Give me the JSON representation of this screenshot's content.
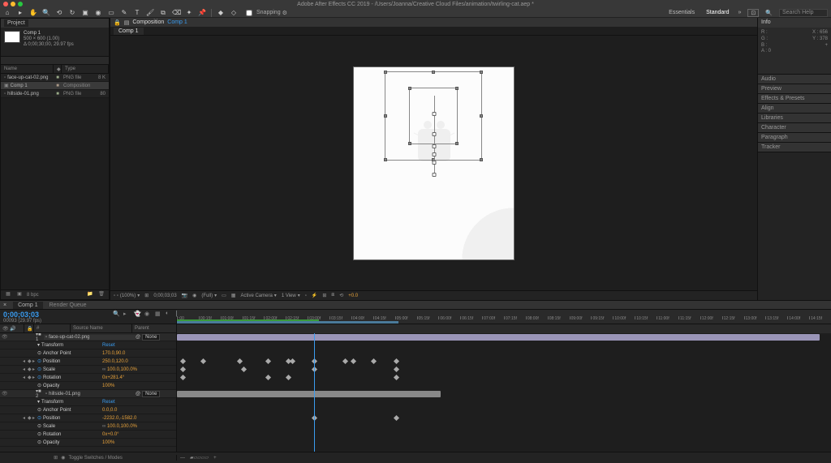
{
  "app": {
    "title": "Adobe After Effects CC 2019 - /Users/Joanna/Creative Cloud Files/animation/twirling-cat.aep *"
  },
  "toolbar": {
    "snapping_label": "Snapping",
    "workspaces": {
      "essentials": "Essentials",
      "standard": "Standard"
    },
    "search_placeholder": "Search Help"
  },
  "project": {
    "tab": "Project",
    "comp_name": "Comp 1",
    "comp_meta1": "500 × 600 (1.00)",
    "comp_meta2": "Δ 0;00;30;00, 29.97 fps",
    "cols": {
      "name": "Name",
      "type": "Type",
      "size": ""
    },
    "items": [
      {
        "name": "face-up-cat-02.png",
        "type": "PNG file",
        "size": "8 K"
      },
      {
        "name": "Comp 1",
        "type": "Composition",
        "size": ""
      },
      {
        "name": "hillside-01.png",
        "type": "PNG file",
        "size": "80"
      }
    ],
    "footer_bpc": "8 bpc"
  },
  "composition": {
    "label": "Composition",
    "name": "Comp 1",
    "tab": "Comp 1"
  },
  "viewer_footer": {
    "zoom": "(100%)",
    "time": "0;00;03;03",
    "res": "(Full)",
    "cam": "Active Camera",
    "view": "1 View",
    "exp": "+0.0"
  },
  "info": {
    "title": "Info",
    "x": "X : 656",
    "y": "Y : 378",
    "r": "R :",
    "g": "G :",
    "b": "B :",
    "a": "A : 0"
  },
  "right_panels": [
    "Audio",
    "Preview",
    "Effects & Presets",
    "Align",
    "Libraries",
    "Character",
    "Paragraph",
    "Tracker"
  ],
  "timeline": {
    "tab1": "Comp 1",
    "tab2": "Render Queue",
    "current_time": "0;00;03;03",
    "current_sub": "00093 (29.97 fps)",
    "cols": {
      "c1": "",
      "c2": "#",
      "c3": "Source Name",
      "c4": "Parent"
    },
    "ruler": [
      ":00",
      "00:15f",
      "01:00f",
      "01:15f",
      "02:00f",
      "02:15f",
      "03:00f",
      "03:15f",
      "04:00f",
      "04:15f",
      "05:00f",
      "05:15f",
      "06:00f",
      "06:15f",
      "07:00f",
      "07:15f",
      "08:00f",
      "08:15f",
      "09:00f",
      "09:15f",
      "10:00f",
      "10:15f",
      "11:00f",
      "11:15f",
      "12:00f",
      "12:15f",
      "13:00f",
      "13:15f",
      "14:00f",
      "14:15f"
    ],
    "parent_none": "None",
    "layer1": {
      "num": "1",
      "name": "face-up-cat-02.png",
      "transform": "Transform",
      "reset": "Reset",
      "props": [
        {
          "n": "Anchor Point",
          "v": "170.0,90.0",
          "kf": false
        },
        {
          "n": "Position",
          "v": "250.0,120.0",
          "kf": true
        },
        {
          "n": "Scale",
          "v": "100.0,100.0%",
          "kf": true,
          "link": true
        },
        {
          "n": "Rotation",
          "v": "0x+281.4°",
          "kf": true
        },
        {
          "n": "Opacity",
          "v": "100%",
          "kf": false
        }
      ]
    },
    "layer2": {
      "num": "2",
      "name": "hillside-01.png",
      "transform": "Transform",
      "reset": "Reset",
      "props": [
        {
          "n": "Anchor Point",
          "v": "0.0,0.0",
          "kf": false
        },
        {
          "n": "Position",
          "v": "-2232.0,-1582.0",
          "kf": true
        },
        {
          "n": "Scale",
          "v": "100.0,100.0%",
          "kf": false,
          "link": true
        },
        {
          "n": "Rotation",
          "v": "0x+0.0°",
          "kf": false
        },
        {
          "n": "Opacity",
          "v": "100%",
          "kf": false
        }
      ]
    },
    "footer": {
      "toggle": "Toggle Switches / Modes"
    }
  }
}
